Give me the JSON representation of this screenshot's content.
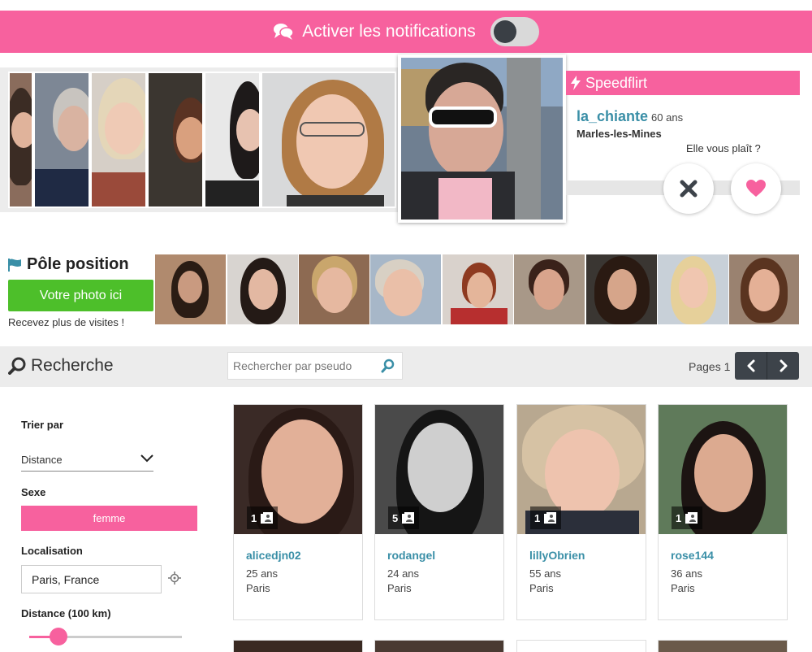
{
  "notification_bar": {
    "label": "Activer les notifications",
    "toggle_on": false,
    "bg_color": "#f7619e"
  },
  "speedflirt": {
    "title": "Speedflirt",
    "name": "la_chiante",
    "age": "60 ans",
    "city": "Marles-les-Mines",
    "question": "Elle vous plaît ?"
  },
  "pole_position": {
    "title": "Pôle position",
    "button": "Votre photo ici",
    "subtitle": "Recevez plus de visites !",
    "button_color": "#4dbf2a"
  },
  "search": {
    "title": "Recherche",
    "pseudo_placeholder": "Rechercher par pseudo",
    "pages_label": "Pages 1"
  },
  "filters": {
    "sort_label": "Trier par",
    "sort_value": "Distance",
    "sex_label": "Sexe",
    "sex_value": "femme",
    "location_label": "Localisation",
    "location_value": "Paris, France",
    "distance_label": "Distance (100 km)",
    "distance_fraction": 0.19
  },
  "profiles": [
    {
      "name": "alicedjn02",
      "age": "25 ans",
      "city": "Paris",
      "photos": "1"
    },
    {
      "name": "rodangel",
      "age": "24 ans",
      "city": "Paris",
      "photos": "5"
    },
    {
      "name": "lillyObrien",
      "age": "55 ans",
      "city": "Paris",
      "photos": "1"
    },
    {
      "name": "rose144",
      "age": "36 ans",
      "city": "Paris",
      "photos": "1"
    }
  ],
  "colors": {
    "accent": "#f7619e",
    "link": "#3a8fa7",
    "nav": "#3d434a"
  }
}
